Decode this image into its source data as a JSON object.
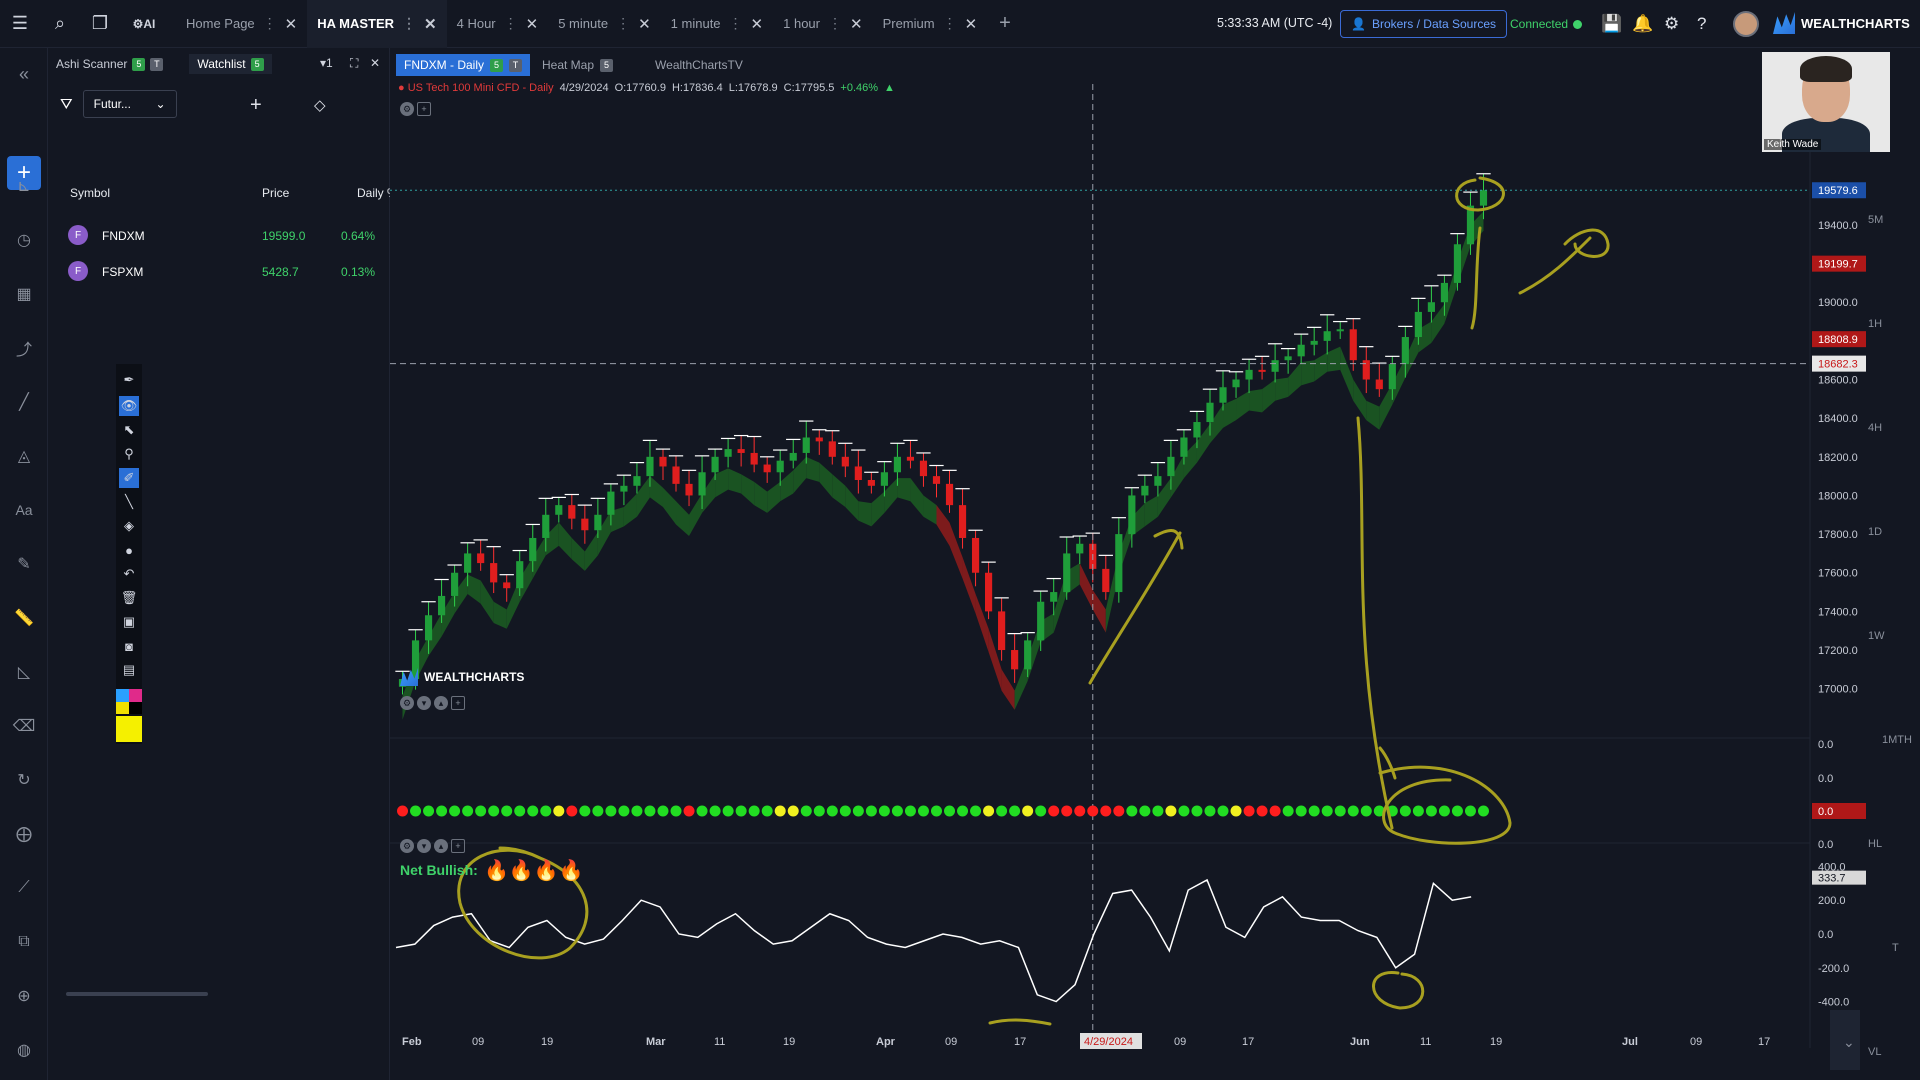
{
  "topbar": {
    "tabs": [
      {
        "label": "Home Page",
        "active": false
      },
      {
        "label": "HA MASTER",
        "active": true
      },
      {
        "label": "4 Hour",
        "active": false
      },
      {
        "label": "5 minute",
        "active": false
      },
      {
        "label": "1 minute",
        "active": false
      },
      {
        "label": "1 hour",
        "active": false
      },
      {
        "label": "Premium",
        "active": false
      }
    ],
    "add_tab": "+",
    "clock": "5:33:33 AM",
    "timezone": "(UTC -4)",
    "brokers_label": "Brokers / Data Sources",
    "connected_label": "Connected",
    "brand": "WEALTHCHARTS",
    "ai_label": "AI"
  },
  "watchlist": {
    "tabs": [
      {
        "label": "Ashi Scanner",
        "badges": [
          "5",
          "T"
        ]
      },
      {
        "label": "Watchlist",
        "badges": [
          "5"
        ]
      }
    ],
    "count": "1",
    "filter_value": "Futur...",
    "columns": [
      "Symbol",
      "Price",
      "Daily %"
    ],
    "rows": [
      {
        "icon": "F",
        "symbol": "FNDXM",
        "price": "19599.0",
        "change": "0.64%"
      },
      {
        "icon": "F",
        "symbol": "FSPXM",
        "price": "5428.7",
        "change": "0.13%"
      }
    ]
  },
  "chart_tabs": [
    {
      "label": "FNDXM - Daily",
      "badges": [
        "5",
        "T"
      ],
      "active": true
    },
    {
      "label": "Heat Map",
      "badges": [
        "5"
      ],
      "active": false
    },
    {
      "label": "WealthChartsTV",
      "badges": [],
      "active": false
    }
  ],
  "legend": {
    "title": "US Tech 100 Mini CFD - Daily",
    "date": "4/29/2024",
    "open": "O:17760.9",
    "high": "H:17836.4",
    "low": "L:17678.9",
    "close": "C:17795.5",
    "change": "+0.46%"
  },
  "indicator_logo": "WEALTHCHARTS",
  "net_bullish": "Net Bullish:",
  "flames": "🔥🔥🔥🔥",
  "webcam_name": "Keith Wade",
  "timeframes": [
    "5M",
    "1H",
    "4H",
    "1D",
    "1W",
    "1MTH",
    "HL",
    "T",
    "VL"
  ],
  "colors": {
    "up": "#1f9e3a",
    "down": "#e01e1e",
    "cloud_up": "#1c5a22",
    "cloud_down": "#8a1c1c",
    "accent": "#2a6fd6",
    "annotation": "#a8a020"
  },
  "chart_data": [
    {
      "type": "candlestick",
      "title": "US Tech 100 Mini CFD - Daily",
      "x_ticks": [
        "Feb",
        "09",
        "19",
        "Mar",
        "11",
        "19",
        "Apr",
        "09",
        "17",
        "4/29/2024",
        "09",
        "17",
        "Jun",
        "11",
        "19",
        "Jul",
        "09",
        "17"
      ],
      "y_ticks": [
        17000.0,
        17200.0,
        17400.0,
        17600.0,
        17800.0,
        18000.0,
        18200.0,
        18400.0,
        18600.0,
        18800.0,
        19000.0,
        19200.0,
        19400.0,
        19600.0
      ],
      "ylim": [
        16900,
        19850
      ],
      "price_labels": {
        "last": "19579.6",
        "high_line": "19199.7",
        "mid_line": "18808.9",
        "crosshair": "18682.3"
      },
      "closes": [
        17050,
        17250,
        17380,
        17480,
        17600,
        17700,
        17650,
        17550,
        17520,
        17660,
        17780,
        17900,
        17950,
        17880,
        17820,
        17900,
        18020,
        18050,
        18100,
        18200,
        18150,
        18060,
        18000,
        18120,
        18200,
        18240,
        18220,
        18160,
        18120,
        18180,
        18220,
        18300,
        18280,
        18200,
        18150,
        18080,
        18050,
        18120,
        18200,
        18180,
        18100,
        18060,
        17950,
        17780,
        17600,
        17400,
        17200,
        17100,
        17250,
        17450,
        17500,
        17700,
        17750,
        17620,
        17500,
        17800,
        18000,
        18050,
        18100,
        18200,
        18300,
        18380,
        18480,
        18560,
        18600,
        18650,
        18640,
        18700,
        18720,
        18780,
        18800,
        18850,
        18860,
        18700,
        18600,
        18550,
        18680,
        18820,
        18950,
        19000,
        19100,
        19300,
        19500,
        19580
      ]
    },
    {
      "type": "dots",
      "y_ticks": [
        "0.0",
        "0.0",
        "0.0",
        "0.0"
      ],
      "value_label": "0.0",
      "colors_sequence": [
        "down",
        "up",
        "up",
        "up",
        "up",
        "up",
        "up",
        "up",
        "up",
        "up",
        "up",
        "up",
        "neutral",
        "down",
        "up",
        "up",
        "up",
        "up",
        "up",
        "up",
        "up",
        "up",
        "down",
        "up",
        "up",
        "up",
        "up",
        "up",
        "up",
        "neutral",
        "neutral",
        "up",
        "up",
        "up",
        "up",
        "up",
        "up",
        "up",
        "up",
        "up",
        "up",
        "up",
        "up",
        "up",
        "up",
        "neutral",
        "up",
        "up",
        "neutral",
        "up",
        "down",
        "down",
        "down",
        "down",
        "down",
        "down",
        "up",
        "up",
        "up",
        "neutral",
        "up",
        "up",
        "up",
        "up",
        "neutral",
        "down",
        "down",
        "down",
        "up",
        "up",
        "up",
        "up",
        "up",
        "up",
        "up",
        "up",
        "up",
        "up",
        "up",
        "up",
        "up",
        "up",
        "up",
        "up",
        "up"
      ]
    },
    {
      "type": "line",
      "y_ticks": [
        400.0,
        200.0,
        0.0,
        -200.0,
        -400.0
      ],
      "ylim": [
        -450,
        450
      ],
      "value_label": "333.7",
      "values": [
        -80,
        -60,
        50,
        100,
        120,
        -40,
        -80,
        40,
        80,
        -20,
        -60,
        -30,
        80,
        200,
        160,
        0,
        -20,
        60,
        120,
        20,
        -60,
        -40,
        40,
        120,
        80,
        -20,
        -60,
        -80,
        -40,
        0,
        -20,
        -60,
        -40,
        -80,
        -360,
        -400,
        -300,
        0,
        240,
        260,
        100,
        -100,
        260,
        320,
        40,
        -20,
        160,
        220,
        100,
        80,
        80,
        20,
        -20,
        -200,
        -120,
        300,
        200,
        220
      ]
    }
  ]
}
